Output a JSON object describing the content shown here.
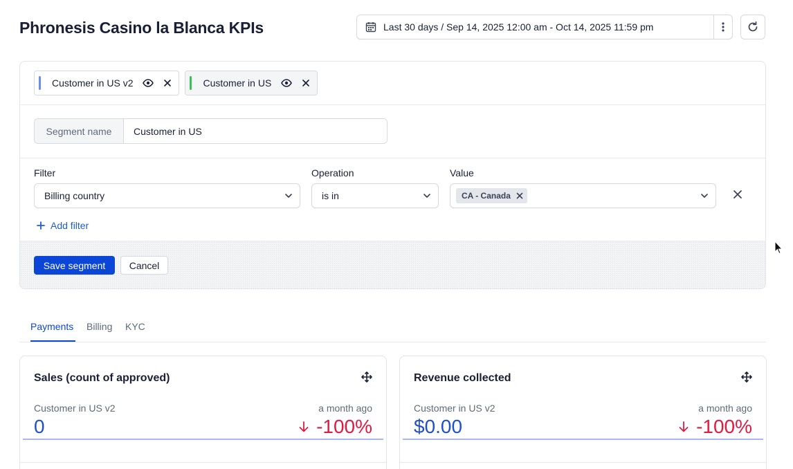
{
  "page": {
    "title": "Phronesis Casino la Blanca KPIs"
  },
  "date_picker": {
    "label": "Last 30 days / Sep 14, 2025 12:00 am - Oct 14, 2025 11:59 pm",
    "icon": "calendar-icon",
    "more_icon": "kebab-menu-icon",
    "refresh_icon": "refresh-icon"
  },
  "segments": {
    "chips": [
      {
        "label": "Customer in US v2",
        "color": "#6c8ee8",
        "active": false
      },
      {
        "label": "Customer in US",
        "color": "#3fbf5a",
        "active": true
      }
    ]
  },
  "editor": {
    "segment_name_label": "Segment name",
    "segment_name_value": "Customer in US",
    "filter_label": "Filter",
    "filter_value": "Billing country",
    "operation_label": "Operation",
    "operation_value": "is in",
    "value_label": "Value",
    "value_tags": [
      "CA - Canada"
    ],
    "add_filter_label": "Add filter",
    "save_label": "Save segment",
    "cancel_label": "Cancel"
  },
  "tabs": [
    {
      "label": "Payments",
      "active": true
    },
    {
      "label": "Billing",
      "active": false
    },
    {
      "label": "KYC",
      "active": false
    }
  ],
  "cards": [
    {
      "title": "Sales (count of approved)",
      "segment": "Customer in US v2",
      "compare": "a month ago",
      "value": "0",
      "change": "-100%"
    },
    {
      "title": "Revenue collected",
      "segment": "Customer in US v2",
      "compare": "a month ago",
      "value": "$0.00",
      "change": "-100%"
    }
  ],
  "colors": {
    "accent": "#0b46d6",
    "negative": "#df1b41",
    "value": "#1f4fc9"
  }
}
